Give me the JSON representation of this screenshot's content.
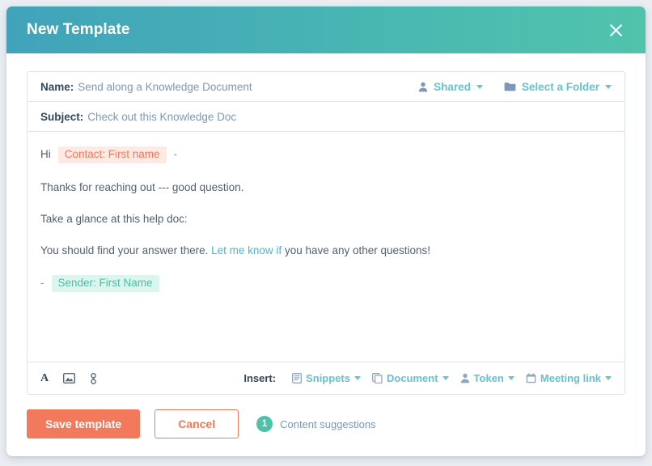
{
  "modal": {
    "title": "New Template",
    "close_icon": "close-icon"
  },
  "form": {
    "name_label": "Name:",
    "name_value": "Send along a Knowledge Document",
    "subject_label": "Subject:",
    "subject_value": "Check out this Knowledge Doc",
    "sharing": {
      "label": "Shared",
      "icon": "person-icon"
    },
    "folder": {
      "label": "Select a Folder",
      "icon": "folder-icon"
    }
  },
  "email": {
    "greeting": "Hi",
    "contact_token": "Contact: First name",
    "greeting_dash": "-",
    "paragraph_1": "Thanks for reaching out --- good question.",
    "paragraph_2": "Take a glance at this help doc:",
    "paragraph_3_before": "You should find your answer there. ",
    "paragraph_3_link": "Let me know if",
    "paragraph_3_after": " you have any other questions!",
    "sign_dash": "-",
    "sender_token": "Sender: First Name"
  },
  "toolbar": {
    "format_icon": "text-format-icon",
    "image_icon": "image-icon",
    "link_icon": "link-icon",
    "insert_label": "Insert:",
    "insert_items": [
      {
        "label": "Snippets",
        "icon": "snippet-icon"
      },
      {
        "label": "Document",
        "icon": "document-icon"
      },
      {
        "label": "Token",
        "icon": "person-icon"
      },
      {
        "label": "Meeting link",
        "icon": "calendar-icon"
      }
    ]
  },
  "footer": {
    "save_label": "Save template",
    "cancel_label": "Cancel",
    "suggestions_count": "1",
    "suggestions_label": "Content suggestions"
  },
  "colors": {
    "header_gradient_start": "#41a3ba",
    "header_gradient_end": "#51c3ac",
    "accent_teal": "#63c3d1",
    "accent_orange": "#f2795c",
    "token_contact_bg": "#fdeae2",
    "token_contact_fg": "#f2775c",
    "token_sender_bg": "#ddf5ef",
    "token_sender_fg": "#45c2a4",
    "badge_green": "#4ec2a9",
    "text_dark": "#33475b",
    "text_muted": "#7c98b6"
  }
}
